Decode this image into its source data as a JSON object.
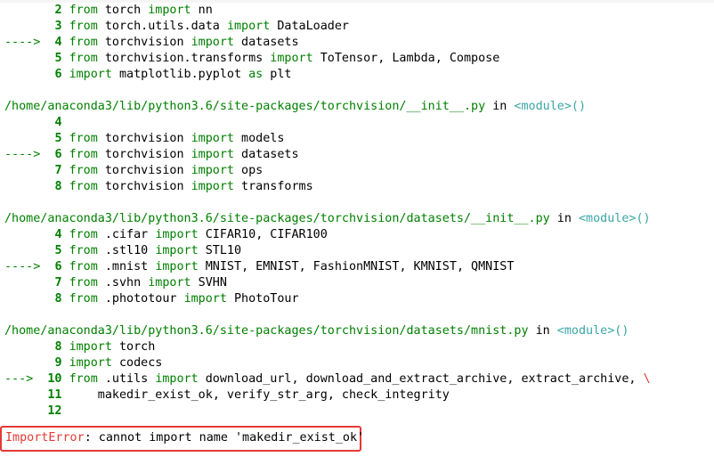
{
  "frames": [
    {
      "lines": [
        {
          "arrow": "",
          "num": "2",
          "parts": [
            [
              "from",
              "kw"
            ],
            [
              " torch ",
              ""
            ],
            [
              "import",
              "kw"
            ],
            [
              " nn",
              ""
            ]
          ]
        },
        {
          "arrow": "",
          "num": "3",
          "parts": [
            [
              "from",
              "kw"
            ],
            [
              " torch.utils.data ",
              ""
            ],
            [
              "import",
              "kw"
            ],
            [
              " DataLoader",
              ""
            ]
          ]
        },
        {
          "arrow": "---->",
          "num": "4",
          "parts": [
            [
              "from",
              "kw"
            ],
            [
              " torchvision ",
              ""
            ],
            [
              "import",
              "kw"
            ],
            [
              " datasets",
              ""
            ]
          ]
        },
        {
          "arrow": "",
          "num": "5",
          "parts": [
            [
              "from",
              "kw"
            ],
            [
              " torchvision.transforms ",
              ""
            ],
            [
              "import",
              "kw"
            ],
            [
              " ToTensor",
              ""
            ],
            [
              ",",
              ""
            ],
            [
              " Lambda",
              ""
            ],
            [
              ",",
              ""
            ],
            [
              " Compose",
              ""
            ]
          ]
        },
        {
          "arrow": "",
          "num": "6",
          "parts": [
            [
              "import",
              "kw"
            ],
            [
              " matplotlib.pyplot ",
              ""
            ],
            [
              "as",
              "kw"
            ],
            [
              " plt",
              ""
            ]
          ]
        }
      ]
    },
    {
      "path": "/home/anaconda3/lib/python3.6/site-packages/torchvision/__init__.py",
      "in_word": "in",
      "context": "<module>()",
      "lines": [
        {
          "arrow": "",
          "num": "4",
          "parts": []
        },
        {
          "arrow": "",
          "num": "5",
          "parts": [
            [
              "from",
              "kw"
            ],
            [
              " torchvision ",
              ""
            ],
            [
              "import",
              "kw"
            ],
            [
              " models",
              ""
            ]
          ]
        },
        {
          "arrow": "---->",
          "num": "6",
          "parts": [
            [
              "from",
              "kw"
            ],
            [
              " torchvision ",
              ""
            ],
            [
              "import",
              "kw"
            ],
            [
              " datasets",
              ""
            ]
          ]
        },
        {
          "arrow": "",
          "num": "7",
          "parts": [
            [
              "from",
              "kw"
            ],
            [
              " torchvision ",
              ""
            ],
            [
              "import",
              "kw"
            ],
            [
              " ops",
              ""
            ]
          ]
        },
        {
          "arrow": "",
          "num": "8",
          "parts": [
            [
              "from",
              "kw"
            ],
            [
              " torchvision ",
              ""
            ],
            [
              "import",
              "kw"
            ],
            [
              " transforms",
              ""
            ]
          ]
        }
      ]
    },
    {
      "path": "/home/anaconda3/lib/python3.6/site-packages/torchvision/datasets/__init__.py",
      "in_word": "in",
      "context": "<module>()",
      "lines": [
        {
          "arrow": "",
          "num": "4",
          "parts": [
            [
              "from",
              "kw"
            ],
            [
              " .cifar ",
              ""
            ],
            [
              "import",
              "kw"
            ],
            [
              " CIFAR10",
              ""
            ],
            [
              ",",
              ""
            ],
            [
              " CIFAR100",
              ""
            ]
          ]
        },
        {
          "arrow": "",
          "num": "5",
          "parts": [
            [
              "from",
              "kw"
            ],
            [
              " .stl10 ",
              ""
            ],
            [
              "import",
              "kw"
            ],
            [
              " STL10",
              ""
            ]
          ]
        },
        {
          "arrow": "---->",
          "num": "6",
          "parts": [
            [
              "from",
              "kw"
            ],
            [
              " .mnist ",
              ""
            ],
            [
              "import",
              "kw"
            ],
            [
              " MNIST",
              ""
            ],
            [
              ",",
              ""
            ],
            [
              " EMNIST",
              ""
            ],
            [
              ",",
              ""
            ],
            [
              " FashionMNIST",
              ""
            ],
            [
              ",",
              ""
            ],
            [
              " KMNIST",
              ""
            ],
            [
              ",",
              ""
            ],
            [
              " QMNIST",
              ""
            ]
          ]
        },
        {
          "arrow": "",
          "num": "7",
          "parts": [
            [
              "from",
              "kw"
            ],
            [
              " .svhn ",
              ""
            ],
            [
              "import",
              "kw"
            ],
            [
              " SVHN",
              ""
            ]
          ]
        },
        {
          "arrow": "",
          "num": "8",
          "parts": [
            [
              "from",
              "kw"
            ],
            [
              " .phototour ",
              ""
            ],
            [
              "import",
              "kw"
            ],
            [
              " PhotoTour",
              ""
            ]
          ]
        }
      ]
    },
    {
      "path": "/home/anaconda3/lib/python3.6/site-packages/torchvision/datasets/mnist.py",
      "in_word": "in",
      "context": "<module>()",
      "lines": [
        {
          "arrow": "",
          "num": "8",
          "parts": [
            [
              "import",
              "kw"
            ],
            [
              " torch",
              ""
            ]
          ]
        },
        {
          "arrow": "",
          "num": "9",
          "parts": [
            [
              "import",
              "kw"
            ],
            [
              " codecs",
              ""
            ]
          ]
        },
        {
          "arrow": "--->",
          "num": "10",
          "parts": [
            [
              "from",
              "kw"
            ],
            [
              " .utils ",
              ""
            ],
            [
              "import",
              "kw"
            ],
            [
              " download_url",
              ""
            ],
            [
              ",",
              ""
            ],
            [
              " download_and_extract_archive",
              ""
            ],
            [
              ",",
              ""
            ],
            [
              " extract_archive",
              ""
            ],
            [
              ",",
              ""
            ],
            [
              " ",
              ""
            ],
            [
              "\\",
              "err"
            ]
          ]
        },
        {
          "arrow": "",
          "num": "11",
          "parts": [
            [
              "    makedir_exist_ok",
              ""
            ],
            [
              ",",
              ""
            ],
            [
              " verify_str_arg",
              ""
            ],
            [
              ",",
              ""
            ],
            [
              " check_integrity",
              ""
            ]
          ]
        },
        {
          "arrow": "",
          "num": "12",
          "parts": []
        }
      ]
    }
  ],
  "error": {
    "type": "ImportError",
    "message": ": cannot import name 'makedir_exist_ok'"
  }
}
